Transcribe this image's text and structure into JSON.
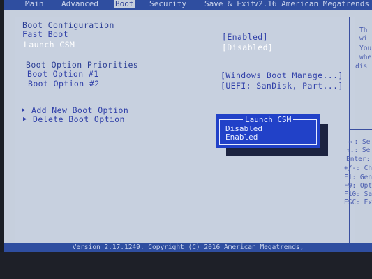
{
  "tabs": [
    {
      "label": "Main"
    },
    {
      "label": "Advanced"
    },
    {
      "label": "Boot"
    },
    {
      "label": "Security"
    },
    {
      "label": "Save & Exit"
    }
  ],
  "vendor_header": "v2.16 American Megatrends",
  "main": {
    "boot_configuration_heading": "Boot Configuration",
    "fast_boot": {
      "label": "Fast Boot",
      "value": "[Enabled]"
    },
    "launch_csm": {
      "label": "Launch CSM",
      "value": "[Disabled]"
    },
    "boot_priorities_heading": "Boot Option Priorities",
    "boot_option_1": {
      "label": "Boot Option #1",
      "value": "[Windows Boot Manage...]"
    },
    "boot_option_2": {
      "label": "Boot Option #2",
      "value": "[UEFI: SanDisk, Part...]"
    },
    "add_new_boot_option": "Add New Boot Option",
    "delete_boot_option": "Delete Boot Option"
  },
  "help_top": [
    "Th",
    "wi",
    "You",
    "whe",
    "dis"
  ],
  "help_keys": [
    "→←: Se",
    "↑↓: Se",
    "Enter:",
    "+/-: Ch",
    "F1: Gen",
    "F9: Opt",
    "F10: Sav",
    "ESC: Ex"
  ],
  "popup": {
    "title": "Launch CSM",
    "options": [
      "Disabled",
      "Enabled"
    ],
    "highlighted": "Enabled"
  },
  "footer": "Version 2.17.1249. Copyright (C) 2016 American Megatrends,",
  "colors": {
    "screen_bg": "#c6cfdd",
    "accent_blue": "#2f4ea0",
    "popup_blue": "#2141c8",
    "item_text": "#2f3fa8"
  }
}
